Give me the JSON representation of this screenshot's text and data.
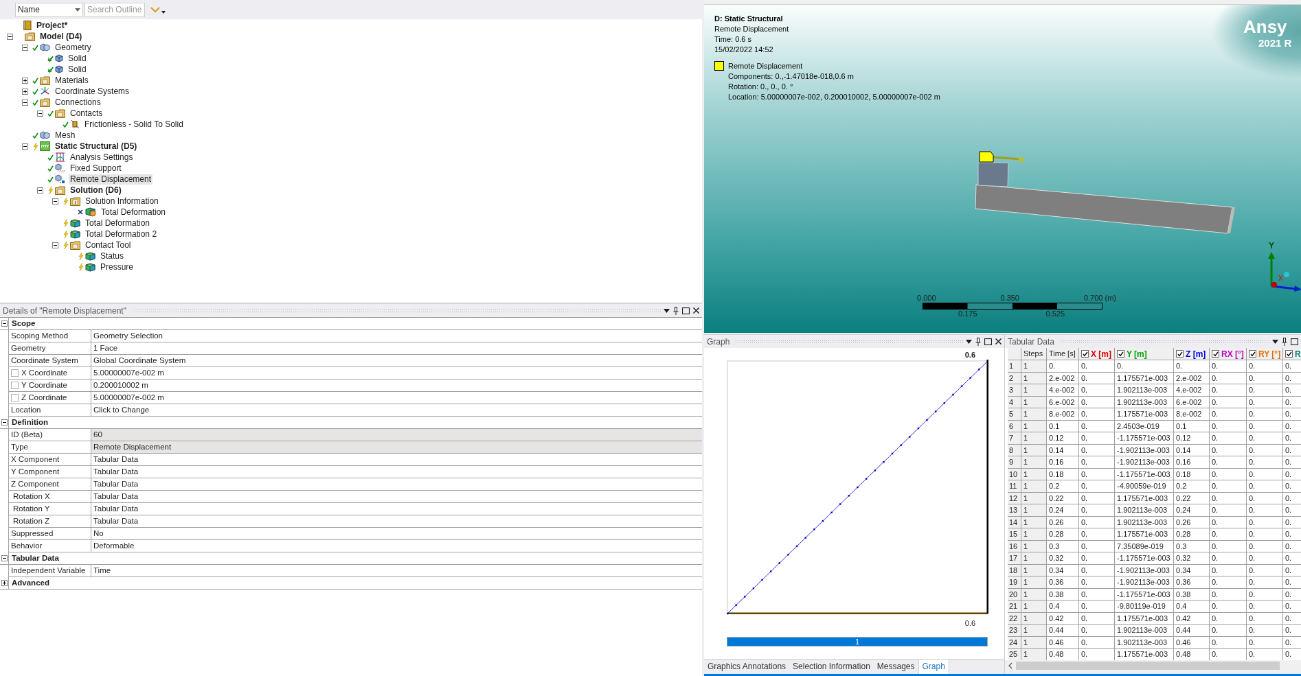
{
  "outline_toolbar": {
    "filter": "Name",
    "search_placeholder": "Search Outline"
  },
  "tree": [
    {
      "label": "Project*",
      "bold": true,
      "selected": false,
      "kind": "book",
      "children": [
        {
          "label": "Model (D4)",
          "bold": true,
          "selected": false,
          "kind": "folder",
          "expanded": true,
          "children": [
            {
              "label": "Geometry",
              "bold": false,
              "selected": false,
              "kind": "cubes",
              "ok": true,
              "crossed": false,
              "expanded": true,
              "children": [
                {
                  "label": "Solid",
                  "bold": false,
                  "selected": false,
                  "kind": "cube",
                  "ok": true,
                  "crossed": true
                },
                {
                  "label": "Solid",
                  "bold": false,
                  "selected": false,
                  "kind": "cube",
                  "ok": true,
                  "crossed": true
                }
              ]
            },
            {
              "label": "Materials",
              "bold": false,
              "selected": false,
              "kind": "folder",
              "ok": true,
              "crossed": false,
              "expanded": false
            },
            {
              "label": "Coordinate Systems",
              "bold": false,
              "selected": false,
              "kind": "axes",
              "ok": true,
              "crossed": false,
              "expanded": false
            },
            {
              "label": "Connections",
              "bold": false,
              "selected": false,
              "kind": "folder",
              "ok": true,
              "crossed": false,
              "expanded": true,
              "children": [
                {
                  "label": "Contacts",
                  "bold": false,
                  "selected": false,
                  "kind": "folder",
                  "ok": true,
                  "crossed": false,
                  "expanded": true,
                  "children": [
                    {
                      "label": "Frictionless - Solid To Solid",
                      "bold": false,
                      "selected": false,
                      "kind": "contact",
                      "ok": true,
                      "crossed": false
                    }
                  ]
                }
              ]
            },
            {
              "label": "Mesh",
              "bold": false,
              "selected": false,
              "kind": "cubes",
              "ok": true,
              "crossed": false
            },
            {
              "label": "Static Structural (D5)",
              "bold": true,
              "selected": false,
              "kind": "analysis",
              "ok": false,
              "crossed": false,
              "expanded": true,
              "children": [
                {
                  "label": "Analysis Settings",
                  "bold": false,
                  "selected": false,
                  "kind": "settings",
                  "ok": true,
                  "crossed": false
                },
                {
                  "label": "Fixed Support",
                  "bold": false,
                  "selected": false,
                  "kind": "support",
                  "ok": true,
                  "crossed": false
                },
                {
                  "label": "Remote Displacement",
                  "bold": false,
                  "selected": true,
                  "kind": "remote",
                  "ok": true,
                  "crossed": false
                },
                {
                  "label": "Solution (D6)",
                  "bold": true,
                  "selected": false,
                  "kind": "folder",
                  "ok": false,
                  "crossed": false,
                  "expanded": true,
                  "children": [
                    {
                      "label": "Solution Information",
                      "bold": false,
                      "selected": false,
                      "kind": "info",
                      "ok": false,
                      "crossed": false,
                      "expanded": true,
                      "children": [
                        {
                          "label": "Total Deformation",
                          "bold": false,
                          "selected": false,
                          "kind": "result-play",
                          "ok": false,
                          "crossed": true
                        }
                      ]
                    },
                    {
                      "label": "Total Deformation",
                      "bold": false,
                      "selected": false,
                      "kind": "result",
                      "ok": false,
                      "crossed": false
                    },
                    {
                      "label": "Total Deformation 2",
                      "bold": false,
                      "selected": false,
                      "kind": "result",
                      "ok": false,
                      "crossed": false
                    },
                    {
                      "label": "Contact Tool",
                      "bold": false,
                      "selected": false,
                      "kind": "folder",
                      "ok": false,
                      "crossed": false,
                      "expanded": true,
                      "children": [
                        {
                          "label": "Status",
                          "bold": false,
                          "selected": false,
                          "kind": "result",
                          "ok": false,
                          "crossed": false
                        },
                        {
                          "label": "Pressure",
                          "bold": false,
                          "selected": false,
                          "kind": "result",
                          "ok": false,
                          "crossed": false
                        }
                      ]
                    }
                  ]
                }
              ]
            }
          ]
        }
      ]
    }
  ],
  "details": {
    "title": "Details of \"Remote Displacement\"",
    "groups": [
      {
        "name": "Scope",
        "expanded": true,
        "rows": [
          {
            "name": "Scoping Method",
            "value": "Geometry Selection",
            "kind": "plain"
          },
          {
            "name": "Geometry",
            "value": "1 Face",
            "kind": "plain"
          },
          {
            "name": "Coordinate System",
            "value": "Global Coordinate System",
            "kind": "plain"
          },
          {
            "name": "X Coordinate",
            "value": "5.00000007e-002 m",
            "kind": "checkbox",
            "checked": false
          },
          {
            "name": "Y Coordinate",
            "value": "0.200010002 m",
            "kind": "checkbox",
            "checked": false
          },
          {
            "name": "Z Coordinate",
            "value": "5.00000007e-002 m",
            "kind": "checkbox",
            "checked": false
          },
          {
            "name": "Location",
            "value": "Click to Change",
            "kind": "plain"
          }
        ]
      },
      {
        "name": "Definition",
        "expanded": true,
        "rows": [
          {
            "name": "ID (Beta)",
            "value": "60",
            "kind": "readonly"
          },
          {
            "name": "Type",
            "value": "Remote Displacement",
            "kind": "readonly"
          },
          {
            "name": "X Component",
            "value": "Tabular Data",
            "kind": "plain"
          },
          {
            "name": "Y Component",
            "value": "Tabular Data",
            "kind": "plain"
          },
          {
            "name": "Z Component",
            "value": "Tabular Data",
            "kind": "plain"
          },
          {
            "name": "Rotation X",
            "value": "Tabular Data",
            "kind": "indented"
          },
          {
            "name": "Rotation Y",
            "value": "Tabular Data",
            "kind": "indented"
          },
          {
            "name": "Rotation Z",
            "value": "Tabular Data",
            "kind": "indented"
          },
          {
            "name": "Suppressed",
            "value": "No",
            "kind": "plain"
          },
          {
            "name": "Behavior",
            "value": "Deformable",
            "kind": "plain"
          }
        ]
      },
      {
        "name": "Tabular Data",
        "expanded": true,
        "rows": [
          {
            "name": "Independent Variable",
            "value": "Time",
            "kind": "plain"
          }
        ]
      },
      {
        "name": "Advanced",
        "expanded": false
      }
    ]
  },
  "viewport": {
    "title": "D: Static Structural",
    "lines": [
      "Remote Displacement",
      "Time: 0.6 s",
      "15/02/2022 14:52"
    ],
    "legend": {
      "title": "Remote Displacement",
      "lines": [
        "Components: 0.,-1.47018e-018,0.6 m",
        "Rotation: 0., 0., 0. °",
        "Location: 5.00000007e-002, 0.200010002, 5.00000007e-002 m"
      ]
    },
    "logo": "Ansy",
    "version": "2021 R",
    "scale": {
      "top_labels": [
        "0.000",
        "0.350",
        "0.700 (m)"
      ],
      "bottom_labels": [
        "0.175",
        "0.525"
      ]
    },
    "triad": [
      "Y",
      "X"
    ]
  },
  "graph": {
    "title": "Graph",
    "y_max_label": "0.6",
    "x_max_label": "0.6",
    "step_label": "1"
  },
  "bottom_tabs": [
    {
      "label": "Graphics Annotations",
      "selected": false
    },
    {
      "label": "Selection Information",
      "selected": false
    },
    {
      "label": "Messages",
      "selected": false
    },
    {
      "label": "Graph",
      "selected": true
    }
  ],
  "tabular": {
    "title": "Tabular Data",
    "columns": [
      {
        "label": "Steps",
        "kind": "plain"
      },
      {
        "label": "Time [s]",
        "kind": "plain"
      },
      {
        "label": "X [m]",
        "kind": "series",
        "checked": true,
        "color": "#e00000"
      },
      {
        "label": "Y [m]",
        "kind": "series",
        "checked": true,
        "color": "#00a000"
      },
      {
        "label": "Z [m]",
        "kind": "series",
        "checked": true,
        "color": "#0000e0"
      },
      {
        "label": "RX [°]",
        "kind": "series",
        "checked": true,
        "color": "#c000c0"
      },
      {
        "label": "RY [°]",
        "kind": "series",
        "checked": true,
        "color": "#e07000"
      },
      {
        "label": "R",
        "kind": "series",
        "checked": true,
        "color": "#008080"
      }
    ],
    "rows": [
      {
        "n": "1",
        "cells": [
          "1",
          "0.",
          "0.",
          "0.",
          "0.",
          "0.",
          "0.",
          "0."
        ]
      },
      {
        "n": "2",
        "cells": [
          "1",
          "2.e-002",
          "0.",
          "1.175571e-003",
          "2.e-002",
          "0.",
          "0.",
          "0."
        ]
      },
      {
        "n": "3",
        "cells": [
          "1",
          "4.e-002",
          "0.",
          "1.902113e-003",
          "4.e-002",
          "0.",
          "0.",
          "0."
        ]
      },
      {
        "n": "4",
        "cells": [
          "1",
          "6.e-002",
          "0.",
          "1.902113e-003",
          "6.e-002",
          "0.",
          "0.",
          "0."
        ]
      },
      {
        "n": "5",
        "cells": [
          "1",
          "8.e-002",
          "0.",
          "1.175571e-003",
          "8.e-002",
          "0.",
          "0.",
          "0."
        ]
      },
      {
        "n": "6",
        "cells": [
          "1",
          "0.1",
          "0.",
          "2.4503e-019",
          "0.1",
          "0.",
          "0.",
          "0."
        ]
      },
      {
        "n": "7",
        "cells": [
          "1",
          "0.12",
          "0.",
          "-1.175571e-003",
          "0.12",
          "0.",
          "0.",
          "0."
        ]
      },
      {
        "n": "8",
        "cells": [
          "1",
          "0.14",
          "0.",
          "-1.902113e-003",
          "0.14",
          "0.",
          "0.",
          "0."
        ]
      },
      {
        "n": "9",
        "cells": [
          "1",
          "0.16",
          "0.",
          "-1.902113e-003",
          "0.16",
          "0.",
          "0.",
          "0."
        ]
      },
      {
        "n": "10",
        "cells": [
          "1",
          "0.18",
          "0.",
          "-1.175571e-003",
          "0.18",
          "0.",
          "0.",
          "0."
        ]
      },
      {
        "n": "11",
        "cells": [
          "1",
          "0.2",
          "0.",
          "-4.90059e-019",
          "0.2",
          "0.",
          "0.",
          "0."
        ]
      },
      {
        "n": "12",
        "cells": [
          "1",
          "0.22",
          "0.",
          "1.175571e-003",
          "0.22",
          "0.",
          "0.",
          "0."
        ]
      },
      {
        "n": "13",
        "cells": [
          "1",
          "0.24",
          "0.",
          "1.902113e-003",
          "0.24",
          "0.",
          "0.",
          "0."
        ]
      },
      {
        "n": "14",
        "cells": [
          "1",
          "0.26",
          "0.",
          "1.902113e-003",
          "0.26",
          "0.",
          "0.",
          "0."
        ]
      },
      {
        "n": "15",
        "cells": [
          "1",
          "0.28",
          "0.",
          "1.175571e-003",
          "0.28",
          "0.",
          "0.",
          "0."
        ]
      },
      {
        "n": "16",
        "cells": [
          "1",
          "0.3",
          "0.",
          "7.35089e-019",
          "0.3",
          "0.",
          "0.",
          "0."
        ]
      },
      {
        "n": "17",
        "cells": [
          "1",
          "0.32",
          "0.",
          "-1.175571e-003",
          "0.32",
          "0.",
          "0.",
          "0."
        ]
      },
      {
        "n": "18",
        "cells": [
          "1",
          "0.34",
          "0.",
          "-1.902113e-003",
          "0.34",
          "0.",
          "0.",
          "0."
        ]
      },
      {
        "n": "19",
        "cells": [
          "1",
          "0.36",
          "0.",
          "-1.902113e-003",
          "0.36",
          "0.",
          "0.",
          "0."
        ]
      },
      {
        "n": "20",
        "cells": [
          "1",
          "0.38",
          "0.",
          "-1.175571e-003",
          "0.38",
          "0.",
          "0.",
          "0."
        ]
      },
      {
        "n": "21",
        "cells": [
          "1",
          "0.4",
          "0.",
          "-9.80119e-019",
          "0.4",
          "0.",
          "0.",
          "0."
        ]
      },
      {
        "n": "22",
        "cells": [
          "1",
          "0.42",
          "0.",
          "1.175571e-003",
          "0.42",
          "0.",
          "0.",
          "0."
        ]
      },
      {
        "n": "23",
        "cells": [
          "1",
          "0.44",
          "0.",
          "1.902113e-003",
          "0.44",
          "0.",
          "0.",
          "0."
        ]
      },
      {
        "n": "24",
        "cells": [
          "1",
          "0.46",
          "0.",
          "1.902113e-003",
          "0.46",
          "0.",
          "0.",
          "0."
        ]
      },
      {
        "n": "25",
        "cells": [
          "1",
          "0.48",
          "0.",
          "1.175571e-003",
          "0.48",
          "0.",
          "0.",
          "0."
        ]
      }
    ]
  }
}
